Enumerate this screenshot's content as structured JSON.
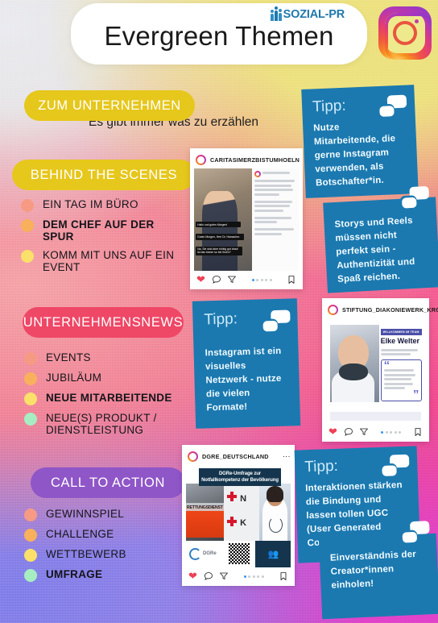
{
  "header": {
    "brand": "SOZIAL-PR",
    "title": "Evergreen Themen",
    "instagram_icon": "instagram-logo",
    "brand_icon": "people-group-icon"
  },
  "sections": [
    {
      "pill": "ZUM UNTERNEHMEN",
      "subtitle": "Es gibt immer was zu erzählen",
      "items": []
    },
    {
      "pill": "BEHIND THE SCENES",
      "items": [
        {
          "label": "EIN TAG IM BÜRO",
          "color": "#f79a84",
          "bold": false
        },
        {
          "label": "DEM CHEF AUF DER SPUR",
          "color": "#f9b05c",
          "bold": true
        },
        {
          "label": "KOMM MIT UNS AUF EIN EVENT",
          "color": "#fbe06a",
          "bold": false
        }
      ]
    },
    {
      "pill": "UNTERNEHMENSNEWS",
      "items": [
        {
          "label": "EVENTS",
          "color": "#f79a84",
          "bold": false
        },
        {
          "label": "JUBILÄUM",
          "color": "#f9b05c",
          "bold": false
        },
        {
          "label": "NEUE MITARBEITENDE",
          "color": "#fbe06a",
          "bold": true
        },
        {
          "label": "NEUE(S) PRODUKT / DIENSTLEISTUNG",
          "color": "#a6eec2",
          "bold": false
        }
      ]
    },
    {
      "pill": "CALL TO ACTION",
      "items": [
        {
          "label": "GEWINNSPIEL",
          "color": "#f79a84",
          "bold": false
        },
        {
          "label": "CHALLENGE",
          "color": "#f9b05c",
          "bold": false
        },
        {
          "label": "WETTBEWERB",
          "color": "#fbe06a",
          "bold": false
        },
        {
          "label": "UMFRAGE",
          "color": "#a6eec2",
          "bold": true
        }
      ]
    }
  ],
  "tips": [
    {
      "title": "Tipp:",
      "body": "Nutze Mitarbeitende, die gerne Instagram verwenden, als Botschafter*in."
    },
    {
      "title": "",
      "body": "Storys und Reels müssen nicht perfekt sein - Authentizität und Spaß reichen."
    },
    {
      "title": "Tipp:",
      "body": "Instagram ist ein visuelles Netzwerk - nutze die vielen Formate!"
    },
    {
      "title": "Tipp:",
      "body": "Interaktionen stärken die Bindung und  lassen tollen UGC (User Generated Content) entstehen."
    },
    {
      "title": "",
      "body": "Einverständnis der Creator*innen einholen!"
    }
  ],
  "posts": [
    {
      "username": "CARITASIMERZBISTUMHOELN",
      "overlays": [
        "Hallo und guten Morgen!",
        "Guten Morgen, Herr Dr. Hamacher.",
        "Na, Sie sind aber richtig gut drauf ist das immer so bei Ihnen?"
      ],
      "icons": [
        "heart-icon",
        "comment-icon",
        "share-icon",
        "bookmark-icon"
      ]
    },
    {
      "username": "STIFTUNG_DIAKONIEWERK_KROPP",
      "badge": "WILLKOMMEN IM TEAM",
      "person_name": "Elke Welter",
      "icons": [
        "heart-icon",
        "comment-icon",
        "share-icon",
        "bookmark-icon"
      ]
    },
    {
      "username": "DGRE_DEUTSCHLAND",
      "banner": "DGRe-Umfrage zur Notfallkompetenz der Bevölkerung",
      "vest_text": "RETTUNGSDIENST",
      "logo_text": "DGRe",
      "icons": [
        "heart-icon",
        "comment-icon",
        "share-icon",
        "bookmark-icon"
      ]
    }
  ],
  "colors": {
    "pill_yellow": "#e6c71c",
    "pill_pink": "#ef4766",
    "pill_purple": "#8f56c8",
    "tip_blue": "#1b79b0",
    "brand_blue": "#1f78ad"
  }
}
